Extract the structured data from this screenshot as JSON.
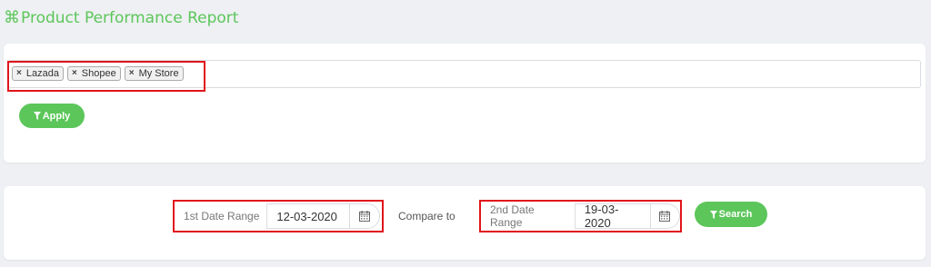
{
  "header": {
    "icon": "command-icon",
    "title": "Product Performance Report"
  },
  "filter": {
    "tags": [
      {
        "label": "Lazada"
      },
      {
        "label": "Shopee"
      },
      {
        "label": "My Store"
      }
    ],
    "remove_symbol": "×",
    "apply_label": "Apply"
  },
  "compare": {
    "range1_label": "1st Date Range",
    "range1_value": "12-03-2020",
    "compare_label": "Compare to",
    "range2_label": "2nd Date Range",
    "range2_value": "19-03-2020",
    "search_label": "Search"
  },
  "colors": {
    "accent": "#5cc65a",
    "highlight": "#e0151b",
    "background": "#eef0f3"
  }
}
